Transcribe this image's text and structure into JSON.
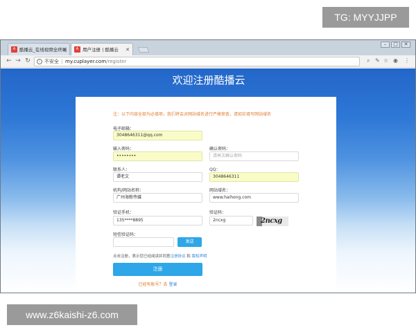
{
  "watermarks": {
    "top": "TG: MYYJJPP",
    "bottom": "www.z6kaishi-z6.com"
  },
  "browser": {
    "tabs": [
      {
        "label": "酷播云_在线视频全终端",
        "active": false
      },
      {
        "label": "用户注册 | 酷播云",
        "active": true
      }
    ],
    "favicon_text": "A",
    "address": {
      "security": "不安全",
      "host": "my.cuplayer.com",
      "path": "/register"
    },
    "nav_icons": [
      "back-arrow-icon",
      "forward-arrow-icon",
      "reload-icon",
      "info-icon"
    ],
    "tool_icons": [
      "search-icon",
      "extension-icon",
      "star-icon",
      "shield-icon",
      "menu-icon"
    ]
  },
  "page": {
    "title": "欢迎注册酷播云",
    "notice": "注：以下内容全部为必填项，我们将会对网站域名进行严格审查，请如实填写网站域名",
    "form": {
      "email": {
        "label": "电子邮箱：",
        "value": "3048646311@qq.com"
      },
      "password": {
        "label": "输入密码：",
        "value": "••••••••"
      },
      "confirm_password": {
        "label": "确认密码：",
        "placeholder": "请再次确认密码"
      },
      "contact": {
        "label": "联系人：",
        "value": "谭老文"
      },
      "qq": {
        "label": "QQ：",
        "value": "3048646311"
      },
      "org": {
        "label": "机构/网站名称：",
        "value": "广州海粉传媒"
      },
      "domain": {
        "label": "网站域名：",
        "value": "www.haihong.com"
      },
      "phone": {
        "label": "验证手机：",
        "value": "135****8895"
      },
      "captcha": {
        "label": "验证码：",
        "value": "2ncxg",
        "image_text": "2ncxg"
      },
      "sms": {
        "label": "短信验证码：",
        "value": ""
      },
      "send_button": "发送",
      "agree_prefix": "点击注册，表示您已经阅读并同意",
      "terms_link": "注册协议",
      "agree_and": "和",
      "copyright_link": "版权声明",
      "register_button": "注册",
      "login_prefix": "已经有账号？去",
      "login_link": "登录"
    }
  },
  "colors": {
    "accent": "#2ea6e8",
    "notice": "#e07b2e",
    "autofill": "#fafcc8",
    "link": "#2e87d9"
  }
}
